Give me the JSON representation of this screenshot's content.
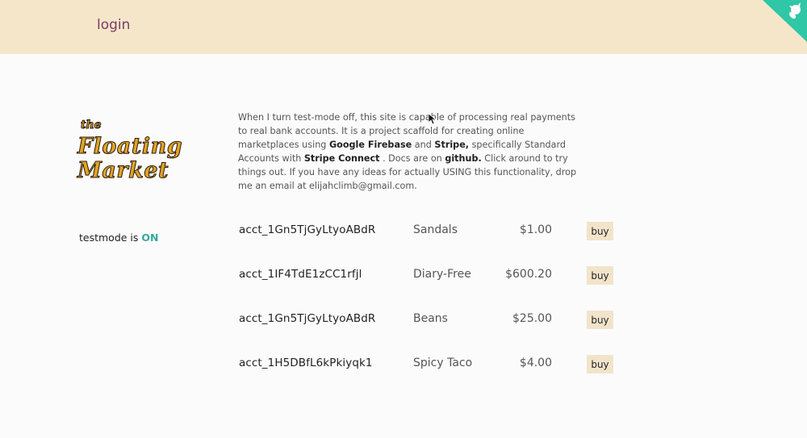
{
  "header": {
    "login_label": "login",
    "background": "#f5e6ca",
    "corner_icon": "github-octocat-icon",
    "corner_color": "#2fc7a5"
  },
  "logo": {
    "the": "the",
    "word1": "Floating",
    "word2": "Market"
  },
  "testmode": {
    "label": "testmode is",
    "status": "ON",
    "status_color": "#33a99a"
  },
  "intro": {
    "p1": "When I turn test-mode off, this site is capable of processing real payments to real bank accounts. It is a project scaffold for creating online marketplaces using ",
    "firebase": "Google Firebase",
    "and": " and ",
    "stripe": "Stripe,",
    "p2": " specifically Standard Accounts with ",
    "stripe_connect": "Stripe Connect",
    "p3": " . Docs are on ",
    "github": "github.",
    "p4": " Click around to try things out. If you have any ideas for actually USING this functionality, drop me an email at elijahclimb@gmail.com."
  },
  "listings": [
    {
      "account": "acct_1Gn5TjGyLtyoABdR",
      "name": "Sandals",
      "price": "$1.00",
      "button": "buy"
    },
    {
      "account": "acct_1IF4TdE1zCC1rfjl",
      "name": "Diary-Free",
      "price": "$600.20",
      "button": "buy"
    },
    {
      "account": "acct_1Gn5TjGyLtyoABdR",
      "name": "Beans",
      "price": "$25.00",
      "button": "buy"
    },
    {
      "account": "acct_1H5DBfL6kPkiyqk1",
      "name": "Spicy Taco",
      "price": "$4.00",
      "button": "buy"
    }
  ]
}
